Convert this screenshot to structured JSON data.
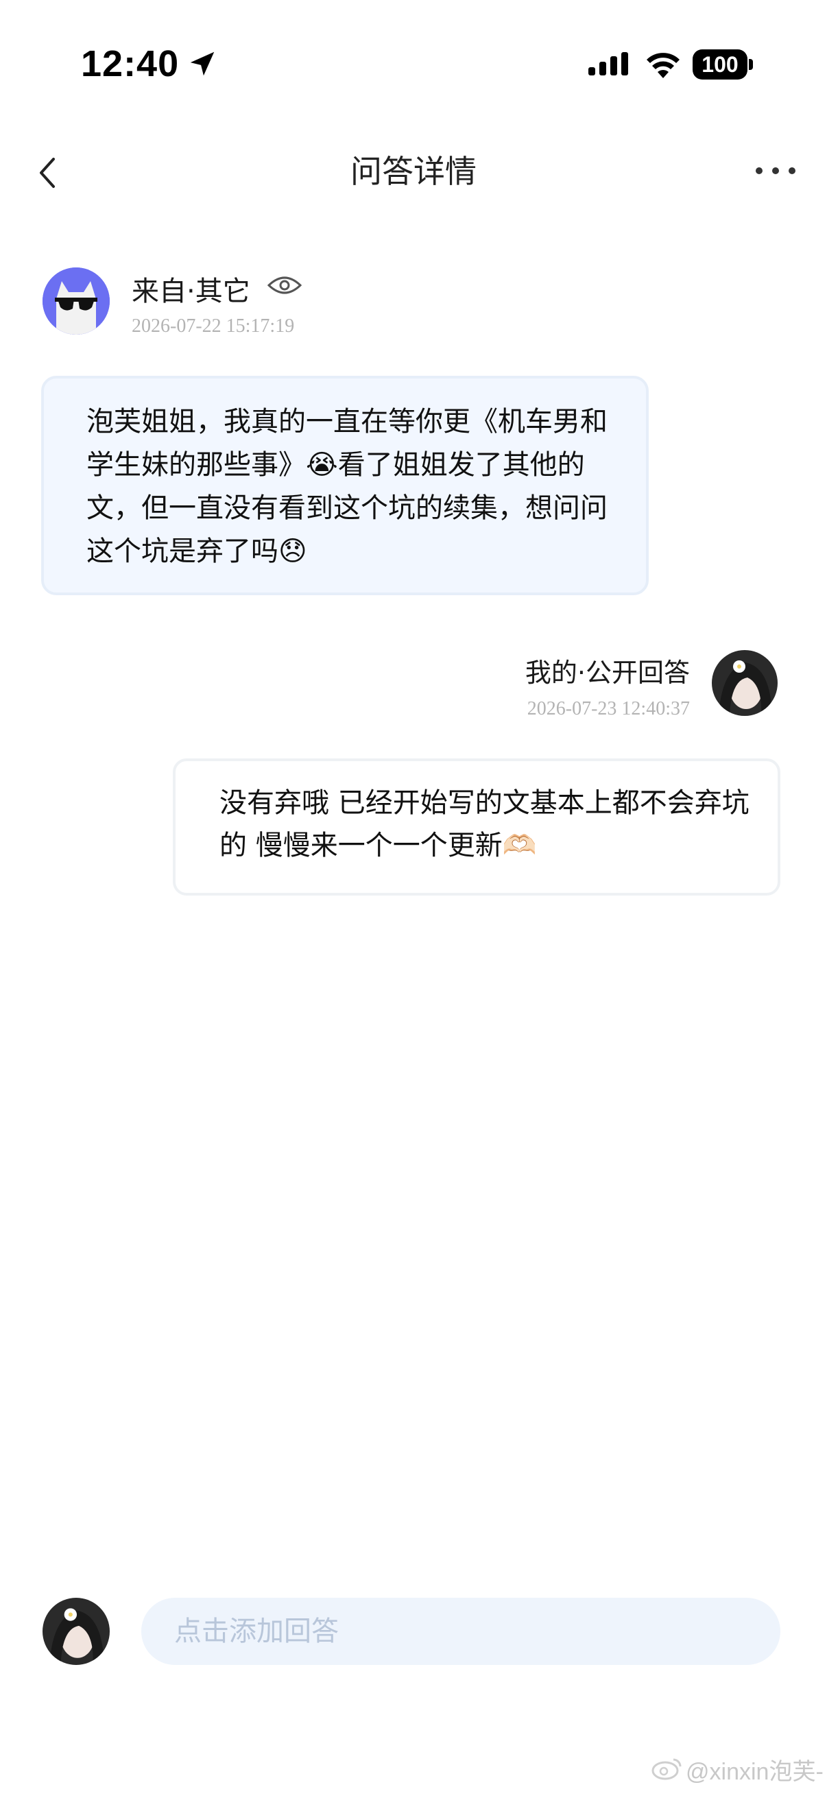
{
  "status_bar": {
    "time": "12:40",
    "battery": "100"
  },
  "header": {
    "title": "问答详情"
  },
  "question": {
    "source": "来自·其它",
    "time": "2026-07-22 15:17:19",
    "text": "泡芙姐姐，我真的一直在等你更《机车男和学生妹的那些事》😭看了姐姐发了其他的文，但一直没有看到这个坑的续集，想问问这个坑是弃了吗😞"
  },
  "answer": {
    "source": "我的·公开回答",
    "time": "2026-07-23 12:40:37",
    "text": "没有弃哦 已经开始写的文基本上都不会弃坑的 慢慢来一个一个更新🫶🏻"
  },
  "composer": {
    "placeholder": "点击添加回答"
  },
  "watermark": {
    "text": "@xinxin泡芙-"
  },
  "colors": {
    "bubble_question_bg": "#f2f7ff",
    "input_bg": "#eef4fc",
    "avatar_question_bg": "#6b6ff2",
    "time_text": "#b3b3b3"
  }
}
